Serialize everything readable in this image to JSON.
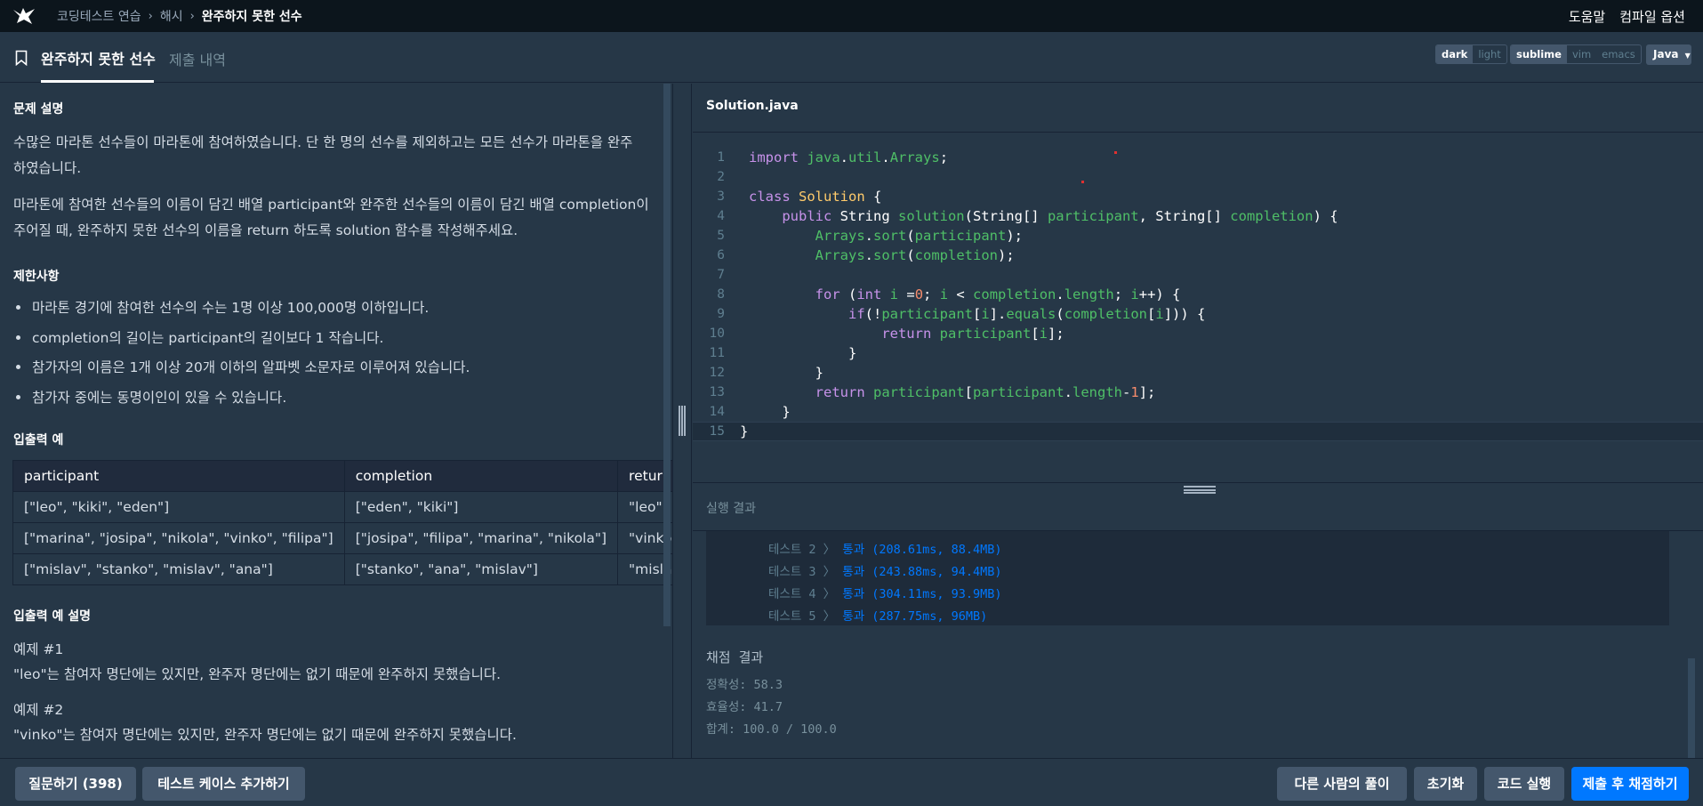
{
  "nav": {
    "breadcrumb": [
      "코딩테스트 연습",
      "해시",
      "완주하지 못한 선수"
    ],
    "help": "도움말",
    "compile_options": "컴파일 옵션"
  },
  "tabs": {
    "active": "완주하지 못한 선수",
    "other": "제출 내역"
  },
  "toggles": {
    "theme": [
      "dark",
      "light"
    ],
    "theme_selected": "dark",
    "keymap": [
      "sublime",
      "vim",
      "emacs"
    ],
    "keymap_selected": "sublime",
    "language": "Java"
  },
  "problem": {
    "desc_title": "문제 설명",
    "desc_p1_l1": "수많은 마라톤 선수들이 마라톤에 참여하였습니다. 단 한 명의 선수를 제외하고는 모든 선수가 마라톤을 완주",
    "desc_p1_l2": "하였습니다.",
    "desc_p2_l1": "마라톤에 참여한 선수들의 이름이 담긴 배열 participant와 완주한 선수들의 이름이 담긴 배열 completion이",
    "desc_p2_l2": "주어질 때, 완주하지 못한 선수의 이름을 return 하도록 solution 함수를 작성해주세요.",
    "constraints_title": "제한사항",
    "constraints": [
      "마라톤 경기에 참여한 선수의 수는 1명 이상 100,000명 이하입니다.",
      "completion의 길이는 participant의 길이보다 1 작습니다.",
      "참가자의 이름은 1개 이상 20개 이하의 알파벳 소문자로 이루어져 있습니다.",
      "참가자 중에는 동명이인이 있을 수 있습니다."
    ],
    "io_title": "입출력 예",
    "io_headers": [
      "participant",
      "completion",
      "return"
    ],
    "io_rows": [
      [
        "[\"leo\", \"kiki\", \"eden\"]",
        "[\"eden\", \"kiki\"]",
        "\"leo\""
      ],
      [
        "[\"marina\", \"josipa\", \"nikola\", \"vinko\", \"filipa\"]",
        "[\"josipa\", \"filipa\", \"marina\", \"nikola\"]",
        "\"vinko\""
      ],
      [
        "[\"mislav\", \"stanko\", \"mislav\", \"ana\"]",
        "[\"stanko\", \"ana\", \"mislav\"]",
        "\"mislav\""
      ]
    ],
    "io_desc_title": "입출력 예 설명",
    "ex1_title": "예제 #1",
    "ex1_text": "\"leo\"는 참여자 명단에는 있지만, 완주자 명단에는 없기 때문에 완주하지 못했습니다.",
    "ex2_title": "예제 #2",
    "ex2_text": "\"vinko\"는 참여자 명단에는 있지만, 완주자 명단에는 없기 때문에 완주하지 못했습니다."
  },
  "editor": {
    "filename": "Solution.java",
    "lines": [
      "import java.util.Arrays;",
      "",
      "class Solution {",
      "    public String solution(String[] participant, String[] completion) {",
      "        Arrays.sort(participant);",
      "        Arrays.sort(completion);",
      "",
      "        for (int i =0; i < completion.length; i++) {",
      "            if(!participant[i].equals(completion[i])) {",
      "                return participant[i];",
      "            }",
      "        }",
      "        return participant[participant.length-1];",
      "    }",
      "}"
    ]
  },
  "output": {
    "title": "실행 결과",
    "tests": [
      {
        "name": "테스트 2",
        "result": "통과 (208.61ms, 88.4MB)"
      },
      {
        "name": "테스트 3",
        "result": "통과 (243.88ms, 94.4MB)"
      },
      {
        "name": "테스트 4",
        "result": "통과 (304.11ms, 93.9MB)"
      },
      {
        "name": "테스트 5",
        "result": "통과 (287.75ms, 96MB)"
      }
    ],
    "grade_title": "채점 결과",
    "accuracy": "정확성: 58.3",
    "efficiency": "효율성: 41.7",
    "total": "합계: 100.0 / 100.0"
  },
  "footer": {
    "ask": "질문하기 (398)",
    "add_testcase": "테스트 케이스 추가하기",
    "others": "다른 사람의 풀이",
    "reset": "초기화",
    "run": "코드 실행",
    "submit": "제출 후 채점하기"
  }
}
